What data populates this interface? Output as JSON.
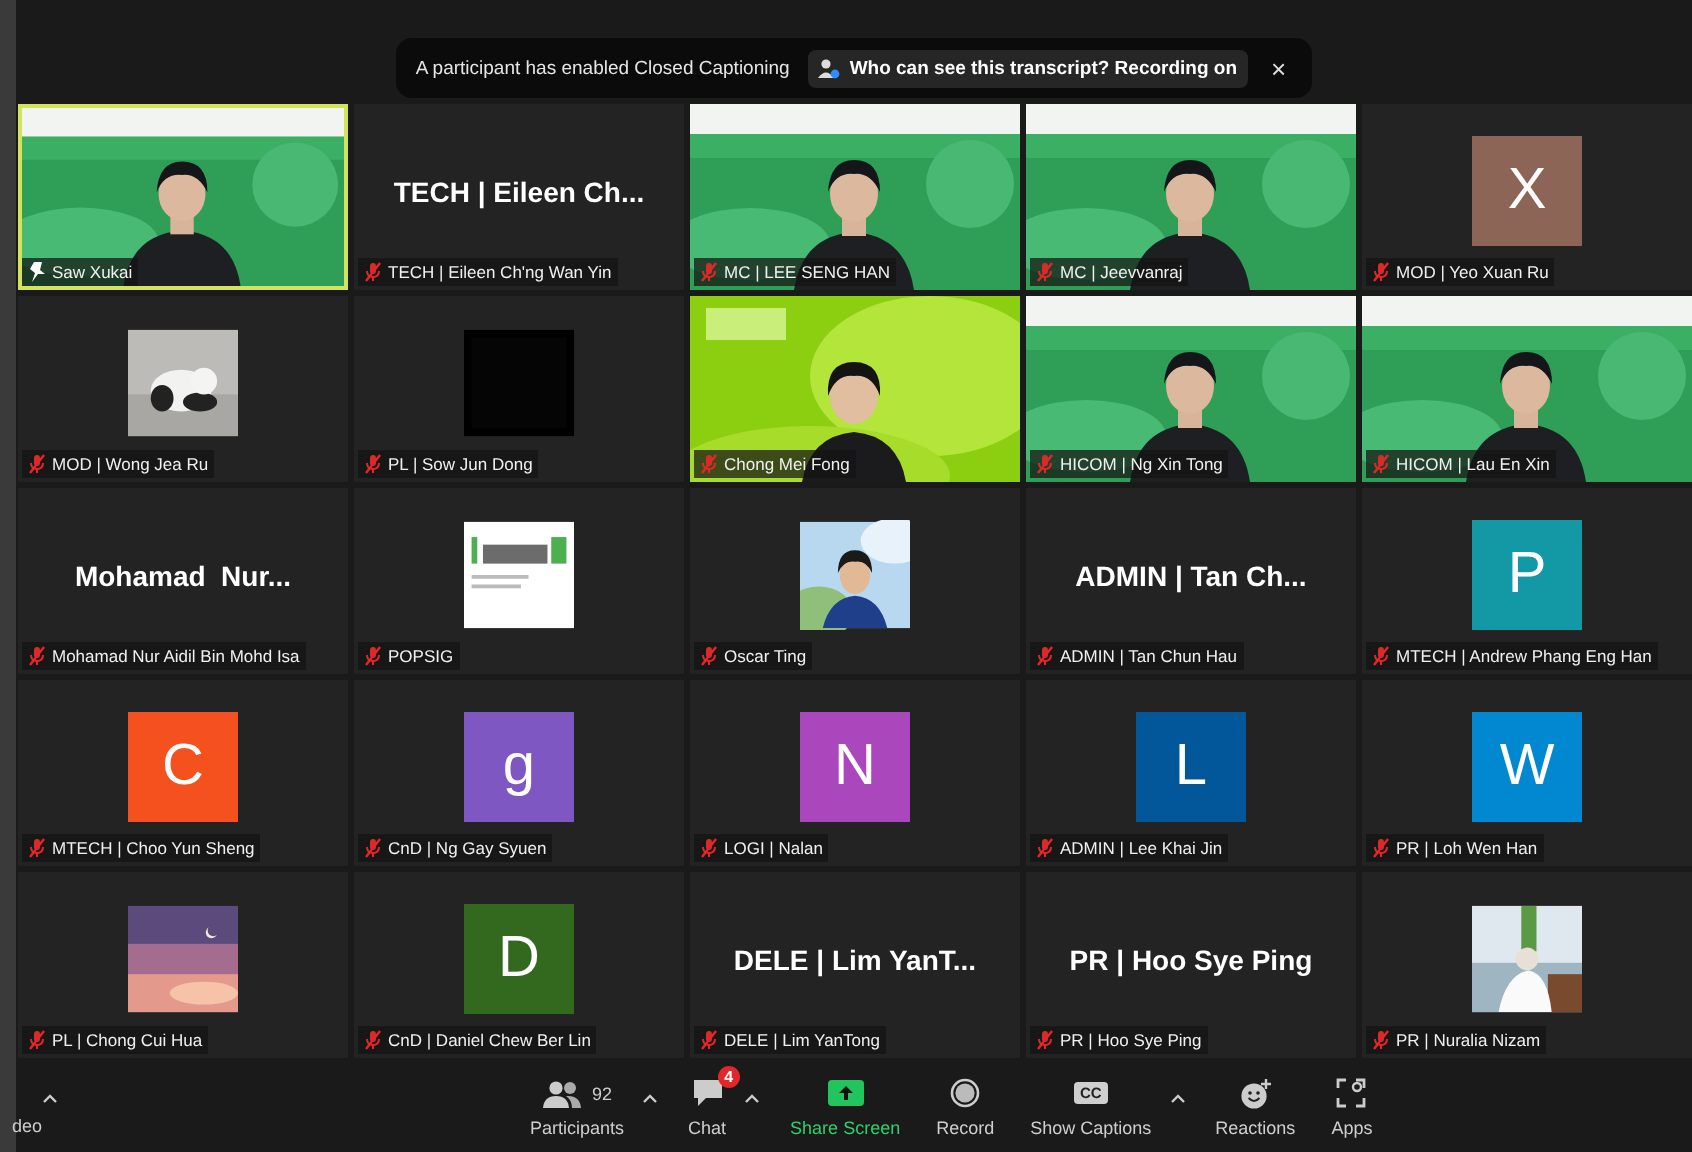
{
  "banner": {
    "message": "A participant has enabled Closed Captioning",
    "link": "Who can see this transcript? Recording on",
    "close": "×"
  },
  "tiles": [
    {
      "kind": "video",
      "name": "Saw Xukai",
      "active": true,
      "pinned": true,
      "muted": false
    },
    {
      "kind": "name",
      "display": "TECH | Eileen Ch...",
      "name": "TECH | Eileen Ch'ng Wan Yin",
      "active": false,
      "pinned": false,
      "muted": true
    },
    {
      "kind": "video",
      "name": "MC | LEE SENG HAN",
      "active": false,
      "pinned": false,
      "muted": true
    },
    {
      "kind": "video",
      "name": "MC | Jeevvanraj",
      "active": false,
      "pinned": false,
      "muted": true
    },
    {
      "kind": "avatar",
      "letter": "X",
      "color": "#8d6557",
      "name": "MOD | Yeo Xuan Ru",
      "active": false,
      "pinned": false,
      "muted": true
    },
    {
      "name": "MOD | Wong Jea Ru",
      "active": false,
      "pinned": false,
      "muted": true
    },
    {
      "name": "PL | Sow Jun Dong",
      "active": false,
      "pinned": false,
      "muted": true
    },
    {
      "kind": "video",
      "name": "Chong Mei Fong",
      "active": false,
      "pinned": false,
      "muted": true
    },
    {
      "kind": "video",
      "name": "HICOM | Ng Xin Tong",
      "active": false,
      "pinned": false,
      "muted": true
    },
    {
      "kind": "video",
      "name": "HICOM | Lau En Xin",
      "active": false,
      "pinned": false,
      "muted": true
    },
    {
      "kind": "name",
      "display": "Mohamad  Nur...",
      "name": "Mohamad Nur Aidil Bin Mohd Isa",
      "active": false,
      "pinned": false,
      "muted": true
    },
    {
      "name": "POPSIG",
      "active": false,
      "pinned": false,
      "muted": true
    },
    {
      "name": "Oscar Ting",
      "active": false,
      "pinned": false,
      "muted": true
    },
    {
      "kind": "name",
      "display": "ADMIN | Tan Ch...",
      "name": "ADMIN | Tan Chun Hau",
      "active": false,
      "pinned": false,
      "muted": true
    },
    {
      "kind": "avatar",
      "letter": "P",
      "color": "#1398a6",
      "name": "MTECH | Andrew Phang Eng Han",
      "active": false,
      "pinned": false,
      "muted": true
    },
    {
      "kind": "avatar",
      "letter": "C",
      "color": "#f4511e",
      "name": "MTECH | Choo Yun Sheng",
      "active": false,
      "pinned": false,
      "muted": true
    },
    {
      "kind": "avatar",
      "letter": "g",
      "color": "#7e57c2",
      "name": "CnD | Ng Gay Syuen",
      "active": false,
      "pinned": false,
      "muted": true
    },
    {
      "kind": "avatar",
      "letter": "N",
      "color": "#ab47bc",
      "name": "LOGI | Nalan",
      "active": false,
      "pinned": false,
      "muted": true
    },
    {
      "kind": "avatar",
      "letter": "L",
      "color": "#02579b",
      "name": "ADMIN | Lee Khai Jin",
      "active": false,
      "pinned": false,
      "muted": true
    },
    {
      "kind": "avatar",
      "letter": "W",
      "color": "#0288d1",
      "name": "PR | Loh Wen Han",
      "active": false,
      "pinned": false,
      "muted": true
    },
    {
      "name": "PL | Chong Cui Hua",
      "active": false,
      "pinned": false,
      "muted": true
    },
    {
      "kind": "avatar",
      "letter": "D",
      "color": "#33691e",
      "name": "CnD | Daniel Chew Ber Lin",
      "active": false,
      "pinned": false,
      "muted": true
    },
    {
      "kind": "name",
      "display": "DELE | Lim YanT...",
      "name": "DELE | Lim YanTong",
      "active": false,
      "pinned": false,
      "muted": true
    },
    {
      "kind": "name",
      "display": "PR | Hoo Sye Ping",
      "name": "PR | Hoo Sye Ping",
      "active": false,
      "pinned": false,
      "muted": true
    },
    {
      "name": "PR | Nuralia Nizam",
      "active": false,
      "pinned": false,
      "muted": true
    }
  ],
  "toolbar": {
    "left": {
      "label": "deo",
      "caret": true
    },
    "items": [
      {
        "kind": "participants",
        "label": "Participants",
        "count": "92",
        "caret": true
      },
      {
        "kind": "chat",
        "label": "Chat",
        "badge": "4",
        "caret": true
      },
      {
        "kind": "share",
        "label": "Share Screen",
        "caret": false
      },
      {
        "kind": "record",
        "label": "Record",
        "caret": false
      },
      {
        "kind": "captions",
        "label": "Show Captions",
        "icon_text": "CC",
        "caret": true
      },
      {
        "kind": "reactions",
        "label": "Reactions",
        "caret": false
      },
      {
        "kind": "apps",
        "label": "Apps",
        "caret": false
      }
    ]
  }
}
